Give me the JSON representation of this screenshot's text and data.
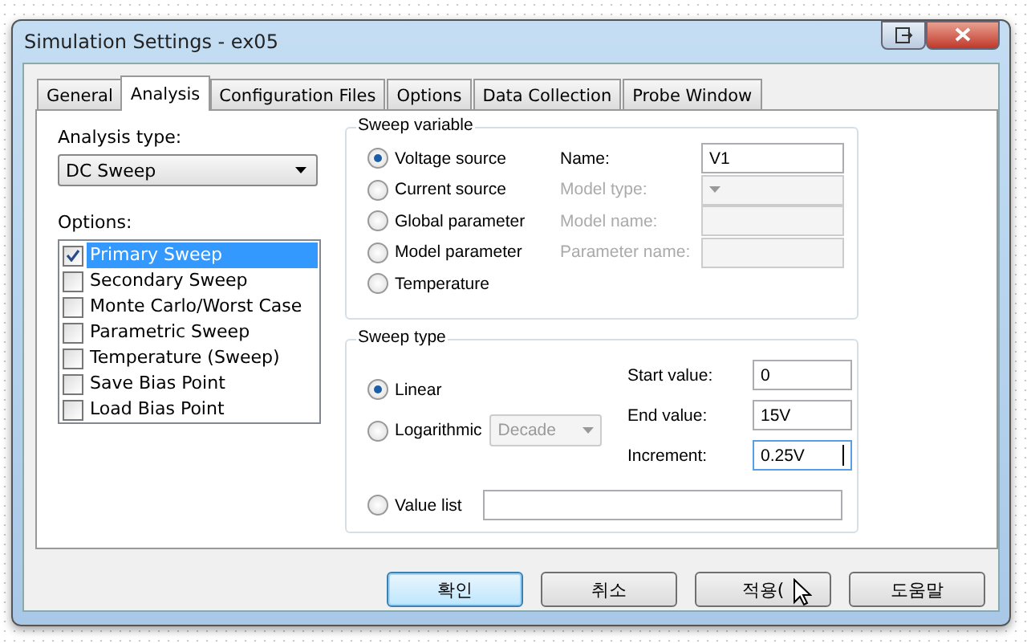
{
  "window": {
    "title": "Simulation Settings - ex05"
  },
  "tabs": [
    {
      "label": "General",
      "selected": false
    },
    {
      "label": "Analysis",
      "selected": true
    },
    {
      "label": "Configuration Files",
      "selected": false
    },
    {
      "label": "Options",
      "selected": false
    },
    {
      "label": "Data Collection",
      "selected": false
    },
    {
      "label": "Probe Window",
      "selected": false
    }
  ],
  "analysis_type": {
    "label": "Analysis type:",
    "value": "DC Sweep"
  },
  "options": {
    "label": "Options:",
    "items": [
      {
        "label": "Primary Sweep",
        "checked": true,
        "selected": true
      },
      {
        "label": "Secondary Sweep",
        "checked": false,
        "selected": false
      },
      {
        "label": "Monte Carlo/Worst Case",
        "checked": false,
        "selected": false
      },
      {
        "label": "Parametric Sweep",
        "checked": false,
        "selected": false
      },
      {
        "label": "Temperature (Sweep)",
        "checked": false,
        "selected": false
      },
      {
        "label": "Save Bias Point",
        "checked": false,
        "selected": false
      },
      {
        "label": "Load Bias Point",
        "checked": false,
        "selected": false
      }
    ]
  },
  "sweep_variable": {
    "title": "Sweep variable",
    "choices": [
      {
        "label": "Voltage source",
        "selected": true
      },
      {
        "label": "Current source",
        "selected": false
      },
      {
        "label": "Global parameter",
        "selected": false
      },
      {
        "label": "Model parameter",
        "selected": false
      },
      {
        "label": "Temperature",
        "selected": false
      }
    ],
    "fields": [
      {
        "kind": "text",
        "label": "Name:",
        "value": "V1",
        "disabled": false
      },
      {
        "kind": "select",
        "label": "Model type:",
        "disabled": true
      },
      {
        "kind": "text",
        "label": "Model name:",
        "disabled": true
      },
      {
        "kind": "text",
        "label": "Parameter name:",
        "disabled": true
      }
    ]
  },
  "sweep_type": {
    "title": "Sweep type",
    "choices": [
      {
        "label": "Linear",
        "selected": true
      },
      {
        "label": "Logarithmic",
        "selected": false
      },
      {
        "label": "Value list",
        "selected": false
      }
    ],
    "log_scale": {
      "value": "Decade",
      "disabled": true
    },
    "fields": [
      {
        "label": "Start value:",
        "value": "0",
        "focused": false
      },
      {
        "label": "End value:",
        "value": "15V",
        "focused": false
      },
      {
        "label": "Increment:",
        "value": "0.25V",
        "focused": true
      }
    ]
  },
  "buttons": [
    {
      "label": "확인",
      "default": true
    },
    {
      "label": "취소",
      "default": false
    },
    {
      "label": "적용(",
      "default": false
    },
    {
      "label": "도움말",
      "default": false
    }
  ]
}
